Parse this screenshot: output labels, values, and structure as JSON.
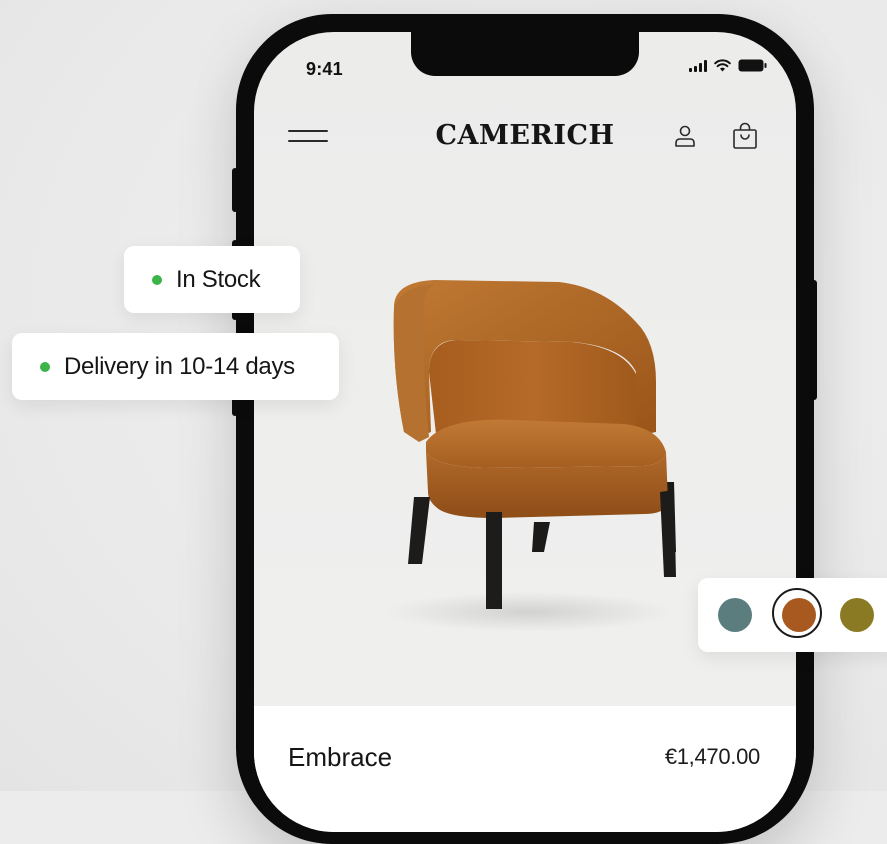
{
  "status_bar": {
    "time": "9:41"
  },
  "header": {
    "brand": "CAMERICH",
    "menu_icon": "hamburger-icon",
    "account_icon": "user-icon",
    "cart_icon": "shopping-bag-icon"
  },
  "badges": {
    "stock": {
      "label": "In Stock",
      "dot_color": "#3cb44a"
    },
    "delivery": {
      "label": "Delivery in 10-14 days",
      "dot_color": "#3cb44a"
    }
  },
  "product": {
    "name": "Embrace",
    "price": "€1,470.00",
    "image": "armchair-tan-leather"
  },
  "colors": {
    "options": [
      {
        "name": "teal",
        "hex": "#5b7d7d"
      },
      {
        "name": "cognac",
        "hex": "#a8591f"
      },
      {
        "name": "olive",
        "hex": "#8a7a24"
      }
    ],
    "selected_index": 1
  }
}
